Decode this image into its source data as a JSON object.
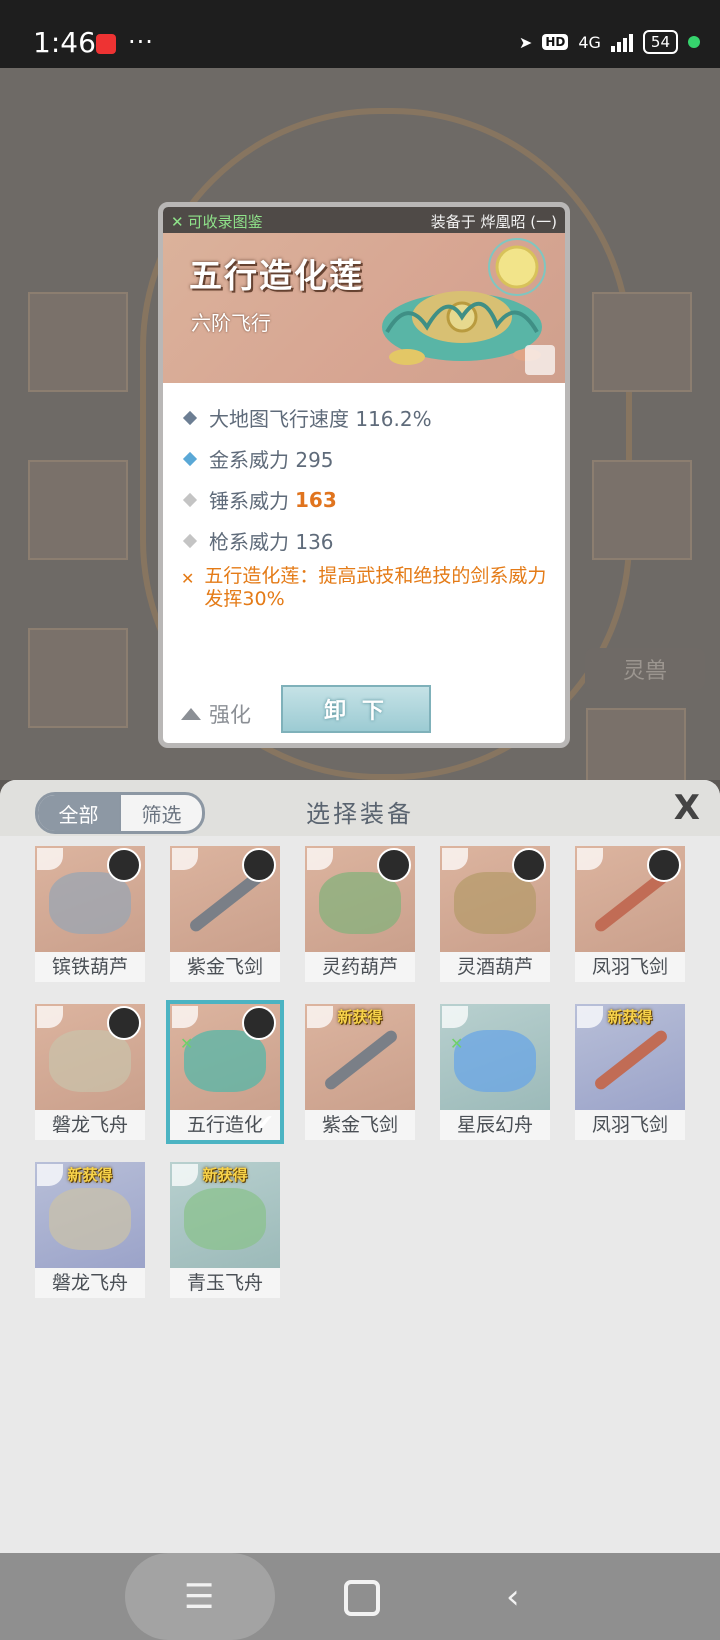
{
  "status_bar": {
    "time": "1:46",
    "dots": "···",
    "hd_label": "HD",
    "network": "4G",
    "battery": "54",
    "icons": [
      "app-notification-icon",
      "location-arrow-icon",
      "hd-icon",
      "signal-icon",
      "battery-icon",
      "green-dot-icon"
    ]
  },
  "background": {
    "tag_label": "灵兽"
  },
  "detail_card": {
    "collect_label": "可收录图鉴",
    "equipped_label": "装备于 烨凰昭 (一)",
    "title": "五行造化莲",
    "subtitle": "六阶飞行",
    "stats": [
      {
        "label": "大地图飞行速度 116.2%",
        "highlight": "",
        "color": "#6c7e93"
      },
      {
        "label": "金系威力 295",
        "highlight": "",
        "color": "#5aa8d6"
      },
      {
        "label": "锤系威力",
        "highlight": "163",
        "color": "#c4c4c4"
      },
      {
        "label": "枪系威力 136",
        "highlight": "",
        "color": "#c4c4c4"
      }
    ],
    "skill_text": "五行造化莲：提高武技和绝技的剑系威力发挥30%",
    "enhance_label": "强化",
    "unload_label": "卸 下"
  },
  "panel": {
    "filter_all": "全部",
    "filter_select": "筛选",
    "title": "选择装备",
    "close": "X",
    "new_tag": "新获得",
    "items": [
      {
        "name": "镔铁葫芦",
        "bg": "warm",
        "shape": "blob",
        "color": "#9aa5b3",
        "avatar": true,
        "new": false
      },
      {
        "name": "紫金飞剑",
        "bg": "warm",
        "shape": "sword",
        "color": "#7a7f87",
        "avatar": true,
        "new": false
      },
      {
        "name": "灵药葫芦",
        "bg": "warm",
        "shape": "blob",
        "color": "#86b27c",
        "avatar": true,
        "new": false
      },
      {
        "name": "灵酒葫芦",
        "bg": "warm",
        "shape": "blob",
        "color": "#b59b6b",
        "avatar": true,
        "new": false
      },
      {
        "name": "凤羽飞剑",
        "bg": "warm",
        "shape": "sword",
        "color": "#c16c55",
        "avatar": true,
        "new": false
      },
      {
        "name": "磐龙飞舟",
        "bg": "warm",
        "shape": "blob",
        "color": "#c9c2a9",
        "avatar": true,
        "new": false
      },
      {
        "name": "五行造化",
        "bg": "warm",
        "shape": "blob",
        "color": "#55b7a8",
        "avatar": true,
        "new": false,
        "selected": true
      },
      {
        "name": "紫金飞剑",
        "bg": "warm",
        "shape": "sword",
        "color": "#7a7f87",
        "avatar": false,
        "new": true
      },
      {
        "name": "星辰幻舟",
        "bg": "tealish",
        "shape": "blob",
        "color": "#6aa5e6",
        "avatar": false,
        "new": false,
        "lock": true
      },
      {
        "name": "凤羽飞剑",
        "bg": "cool",
        "shape": "sword",
        "color": "#c16c55",
        "avatar": false,
        "new": true
      },
      {
        "name": "磐龙飞舟",
        "bg": "cool",
        "shape": "blob",
        "color": "#c9c2a9",
        "avatar": false,
        "new": true
      },
      {
        "name": "青玉飞舟",
        "bg": "tealish",
        "shape": "blob",
        "color": "#8bc28d",
        "avatar": false,
        "new": true
      }
    ]
  },
  "navbar": {
    "menu_glyph": "☰",
    "back_glyph": "‹"
  }
}
